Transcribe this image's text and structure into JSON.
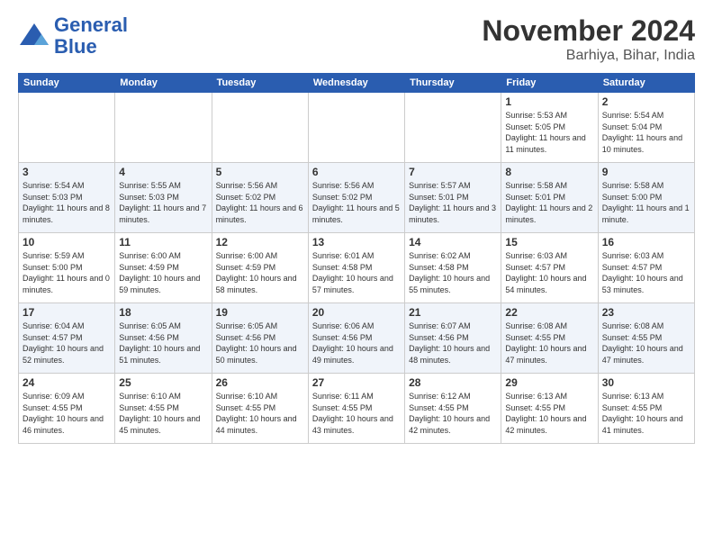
{
  "header": {
    "logo_line1": "General",
    "logo_line2": "Blue",
    "month": "November 2024",
    "location": "Barhiya, Bihar, India"
  },
  "weekdays": [
    "Sunday",
    "Monday",
    "Tuesday",
    "Wednesday",
    "Thursday",
    "Friday",
    "Saturday"
  ],
  "weeks": [
    [
      {
        "day": "",
        "info": ""
      },
      {
        "day": "",
        "info": ""
      },
      {
        "day": "",
        "info": ""
      },
      {
        "day": "",
        "info": ""
      },
      {
        "day": "",
        "info": ""
      },
      {
        "day": "1",
        "info": "Sunrise: 5:53 AM\nSunset: 5:05 PM\nDaylight: 11 hours and 11 minutes."
      },
      {
        "day": "2",
        "info": "Sunrise: 5:54 AM\nSunset: 5:04 PM\nDaylight: 11 hours and 10 minutes."
      }
    ],
    [
      {
        "day": "3",
        "info": "Sunrise: 5:54 AM\nSunset: 5:03 PM\nDaylight: 11 hours and 8 minutes."
      },
      {
        "day": "4",
        "info": "Sunrise: 5:55 AM\nSunset: 5:03 PM\nDaylight: 11 hours and 7 minutes."
      },
      {
        "day": "5",
        "info": "Sunrise: 5:56 AM\nSunset: 5:02 PM\nDaylight: 11 hours and 6 minutes."
      },
      {
        "day": "6",
        "info": "Sunrise: 5:56 AM\nSunset: 5:02 PM\nDaylight: 11 hours and 5 minutes."
      },
      {
        "day": "7",
        "info": "Sunrise: 5:57 AM\nSunset: 5:01 PM\nDaylight: 11 hours and 3 minutes."
      },
      {
        "day": "8",
        "info": "Sunrise: 5:58 AM\nSunset: 5:01 PM\nDaylight: 11 hours and 2 minutes."
      },
      {
        "day": "9",
        "info": "Sunrise: 5:58 AM\nSunset: 5:00 PM\nDaylight: 11 hours and 1 minute."
      }
    ],
    [
      {
        "day": "10",
        "info": "Sunrise: 5:59 AM\nSunset: 5:00 PM\nDaylight: 11 hours and 0 minutes."
      },
      {
        "day": "11",
        "info": "Sunrise: 6:00 AM\nSunset: 4:59 PM\nDaylight: 10 hours and 59 minutes."
      },
      {
        "day": "12",
        "info": "Sunrise: 6:00 AM\nSunset: 4:59 PM\nDaylight: 10 hours and 58 minutes."
      },
      {
        "day": "13",
        "info": "Sunrise: 6:01 AM\nSunset: 4:58 PM\nDaylight: 10 hours and 57 minutes."
      },
      {
        "day": "14",
        "info": "Sunrise: 6:02 AM\nSunset: 4:58 PM\nDaylight: 10 hours and 55 minutes."
      },
      {
        "day": "15",
        "info": "Sunrise: 6:03 AM\nSunset: 4:57 PM\nDaylight: 10 hours and 54 minutes."
      },
      {
        "day": "16",
        "info": "Sunrise: 6:03 AM\nSunset: 4:57 PM\nDaylight: 10 hours and 53 minutes."
      }
    ],
    [
      {
        "day": "17",
        "info": "Sunrise: 6:04 AM\nSunset: 4:57 PM\nDaylight: 10 hours and 52 minutes."
      },
      {
        "day": "18",
        "info": "Sunrise: 6:05 AM\nSunset: 4:56 PM\nDaylight: 10 hours and 51 minutes."
      },
      {
        "day": "19",
        "info": "Sunrise: 6:05 AM\nSunset: 4:56 PM\nDaylight: 10 hours and 50 minutes."
      },
      {
        "day": "20",
        "info": "Sunrise: 6:06 AM\nSunset: 4:56 PM\nDaylight: 10 hours and 49 minutes."
      },
      {
        "day": "21",
        "info": "Sunrise: 6:07 AM\nSunset: 4:56 PM\nDaylight: 10 hours and 48 minutes."
      },
      {
        "day": "22",
        "info": "Sunrise: 6:08 AM\nSunset: 4:55 PM\nDaylight: 10 hours and 47 minutes."
      },
      {
        "day": "23",
        "info": "Sunrise: 6:08 AM\nSunset: 4:55 PM\nDaylight: 10 hours and 47 minutes."
      }
    ],
    [
      {
        "day": "24",
        "info": "Sunrise: 6:09 AM\nSunset: 4:55 PM\nDaylight: 10 hours and 46 minutes."
      },
      {
        "day": "25",
        "info": "Sunrise: 6:10 AM\nSunset: 4:55 PM\nDaylight: 10 hours and 45 minutes."
      },
      {
        "day": "26",
        "info": "Sunrise: 6:10 AM\nSunset: 4:55 PM\nDaylight: 10 hours and 44 minutes."
      },
      {
        "day": "27",
        "info": "Sunrise: 6:11 AM\nSunset: 4:55 PM\nDaylight: 10 hours and 43 minutes."
      },
      {
        "day": "28",
        "info": "Sunrise: 6:12 AM\nSunset: 4:55 PM\nDaylight: 10 hours and 42 minutes."
      },
      {
        "day": "29",
        "info": "Sunrise: 6:13 AM\nSunset: 4:55 PM\nDaylight: 10 hours and 42 minutes."
      },
      {
        "day": "30",
        "info": "Sunrise: 6:13 AM\nSunset: 4:55 PM\nDaylight: 10 hours and 41 minutes."
      }
    ]
  ]
}
